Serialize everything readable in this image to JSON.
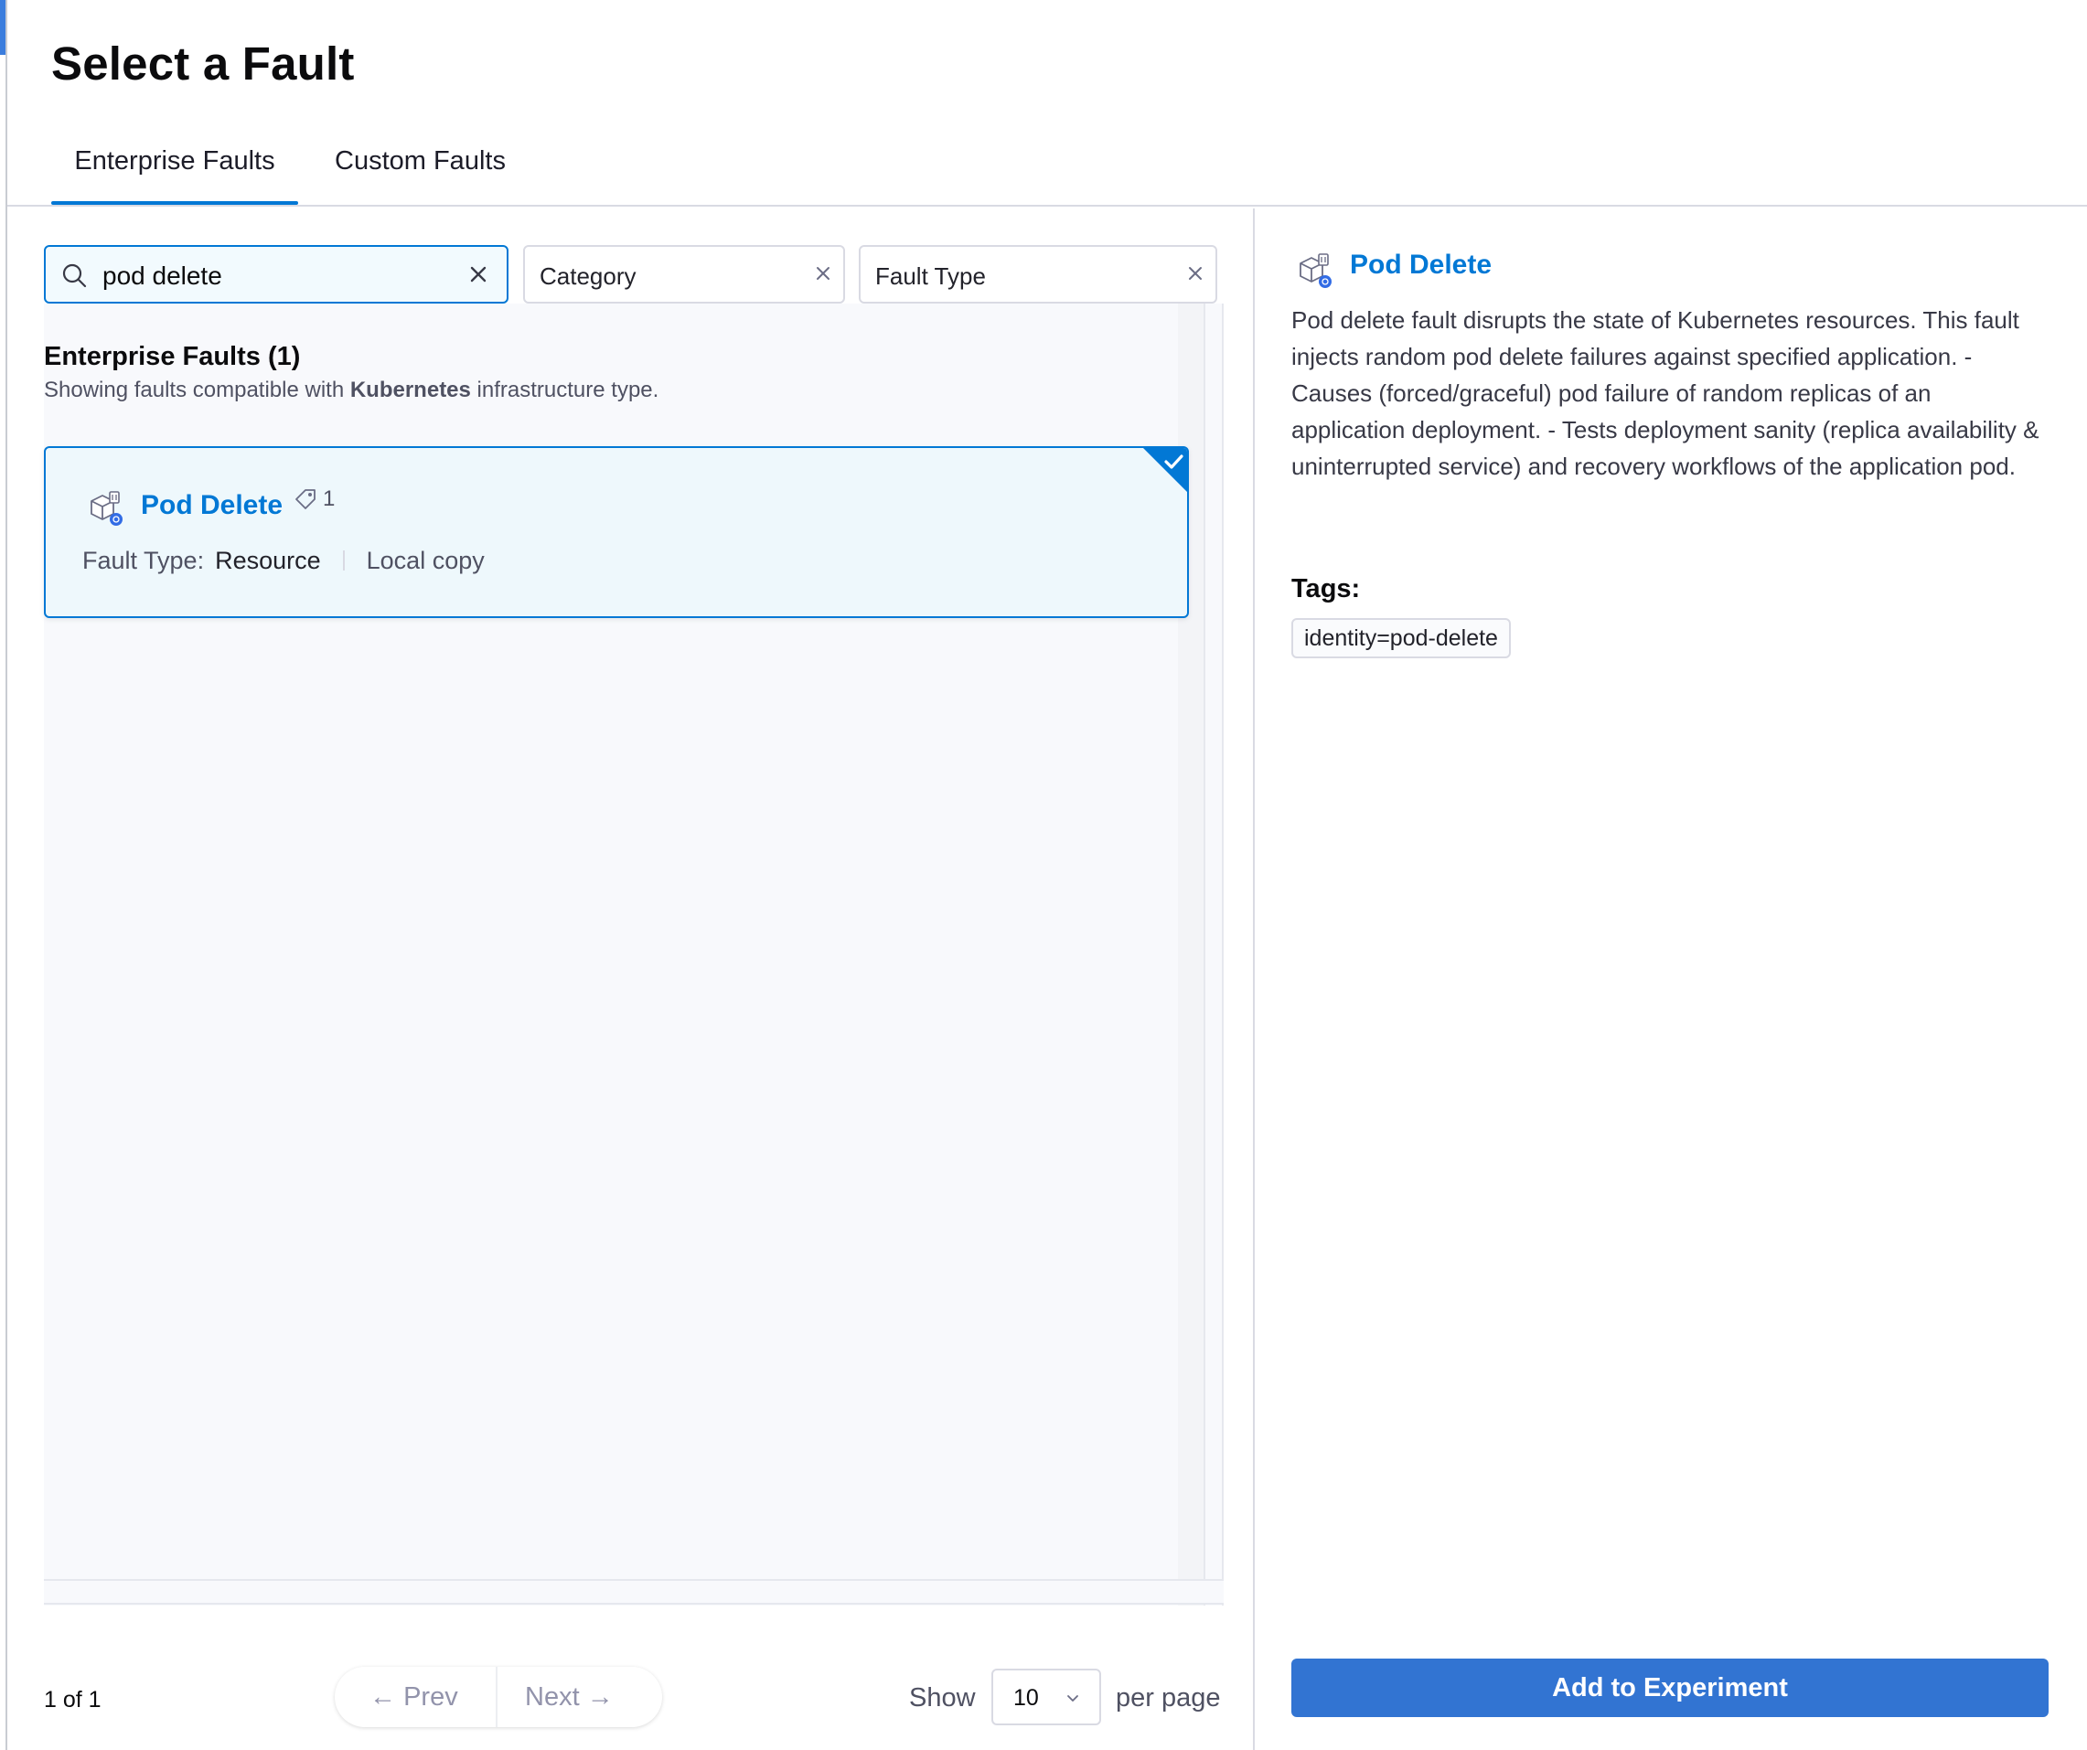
{
  "header": {
    "title": "Select a Fault",
    "tabs": [
      {
        "label": "Enterprise Faults",
        "active": true
      },
      {
        "label": "Custom Faults",
        "active": false
      }
    ]
  },
  "filters": {
    "search": {
      "value": "pod delete",
      "icon": "search-icon"
    },
    "category": {
      "label": "Category"
    },
    "fault_type": {
      "label": "Fault Type"
    }
  },
  "results": {
    "heading": "Enterprise Faults (1)",
    "subtitle_prefix": "Showing faults compatible with ",
    "subtitle_infra": "Kubernetes",
    "subtitle_suffix": " infrastructure type.",
    "items": [
      {
        "name": "Pod Delete",
        "tag_count": "1",
        "fault_type_label": "Fault Type:",
        "fault_type_value": "Resource",
        "source": "Local copy",
        "selected": true
      }
    ]
  },
  "pagination": {
    "page_info": "1 of 1",
    "prev_label": "Prev",
    "next_label": "Next",
    "show_label": "Show",
    "per_page_value": "10",
    "per_page_suffix": "per page"
  },
  "detail": {
    "title": "Pod Delete",
    "description": "Pod delete fault disrupts the state of Kubernetes resources. This fault injects random pod delete failures against specified application. - Causes (forced/graceful) pod failure of random replicas of an application deployment. - Tests deployment sanity (replica availability & uninterrupted service) and recovery workflows of the application pod.",
    "tags_label": "Tags:",
    "tags": [
      "identity=pod-delete"
    ],
    "add_button": "Add to Experiment"
  },
  "colors": {
    "accent": "#0278d5",
    "primary_button": "#3274d2",
    "selected_card_bg": "#eef8fc"
  }
}
